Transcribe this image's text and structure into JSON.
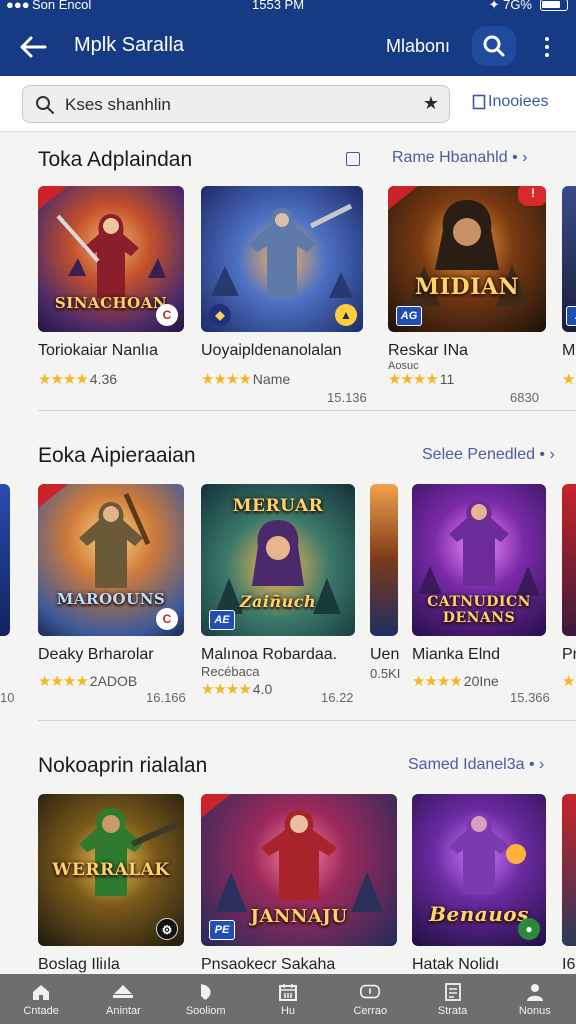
{
  "status_bar": {
    "carrier": "Son Encol",
    "time": "1553 PM",
    "battery": "7G%"
  },
  "app_bar": {
    "title": "Mplk Saralla",
    "action_label": "Mlabonı"
  },
  "search": {
    "value": "Kses shanhlin",
    "filter_label": "Inooiees"
  },
  "sections": [
    {
      "title": "Toka Adplaindan",
      "link": "Rame Hbanahld",
      "cards": [
        {
          "name": "Toriokaiar Nanlıa",
          "rating": "4.36",
          "count": "",
          "logo": "SINACHOAN",
          "publisher": ""
        },
        {
          "name": "Uoyaipldenanolalan",
          "rating": "Name",
          "count": "15.136",
          "logo": "",
          "publisher": ""
        },
        {
          "name": "Reskar INa",
          "sub": "Aosuc",
          "rating": "11",
          "count": "6830",
          "logo": "MIDIAN",
          "publisher": "AG"
        },
        {
          "name": "M",
          "rating": "",
          "count": "",
          "logo": "",
          "publisher": "A"
        }
      ]
    },
    {
      "title": "Eoka Aipieraaian",
      "link": "Selee Penedled",
      "cards": [
        {
          "name": "",
          "rating": "",
          "count": "10",
          "logo": "",
          "publisher": ""
        },
        {
          "name": "Deaky Brharolar",
          "rating": "2ADOB",
          "count": "16.166",
          "logo": "MAROOUNS",
          "publisher": ""
        },
        {
          "name": "Malınoa Robardaa.",
          "sub": "Recébaca",
          "rating": "4.0",
          "count": "16.22",
          "logo": "MERUAR",
          "logo2": "Zaiñuch",
          "publisher": "AE"
        },
        {
          "name": "Uen",
          "sub": "0.5KI",
          "rating": "",
          "count": "",
          "logo": "",
          "publisher": ""
        },
        {
          "name": "Mianka Elnd",
          "rating": "20Ine",
          "count": "15.366",
          "logo": "CATNUDICN DENANS",
          "publisher": ""
        },
        {
          "name": "Pr",
          "rating": "",
          "count": "",
          "logo": "",
          "publisher": ""
        }
      ]
    },
    {
      "title": "Nokoaprin rialalan",
      "link": "Samed Idanel3a",
      "cards": [
        {
          "name": "Boslag Iliıla",
          "logo": "WERRALAK",
          "publisher": ""
        },
        {
          "name": "Pnsaokecr Sakaha",
          "logo": "JANNAJU",
          "publisher": "PE"
        },
        {
          "name": "Hatak Nolidı",
          "logo": "Benauos",
          "publisher": ""
        },
        {
          "name": "I6",
          "logo": "",
          "publisher": ""
        }
      ]
    }
  ],
  "bottom_nav": [
    {
      "label": "Cntade",
      "icon": "home-icon"
    },
    {
      "label": "Anintar",
      "icon": "hat-icon"
    },
    {
      "label": "Sooliom",
      "icon": "leaf-icon"
    },
    {
      "label": "Hu",
      "icon": "calendar-icon"
    },
    {
      "label": "Cerrao",
      "icon": "chat-icon"
    },
    {
      "label": "Strata",
      "icon": "list-icon"
    },
    {
      "label": "Nonus",
      "icon": "person-icon"
    }
  ],
  "colors": {
    "brand": "#173a84",
    "star": "#f2b722",
    "link": "#4a5ba8"
  }
}
